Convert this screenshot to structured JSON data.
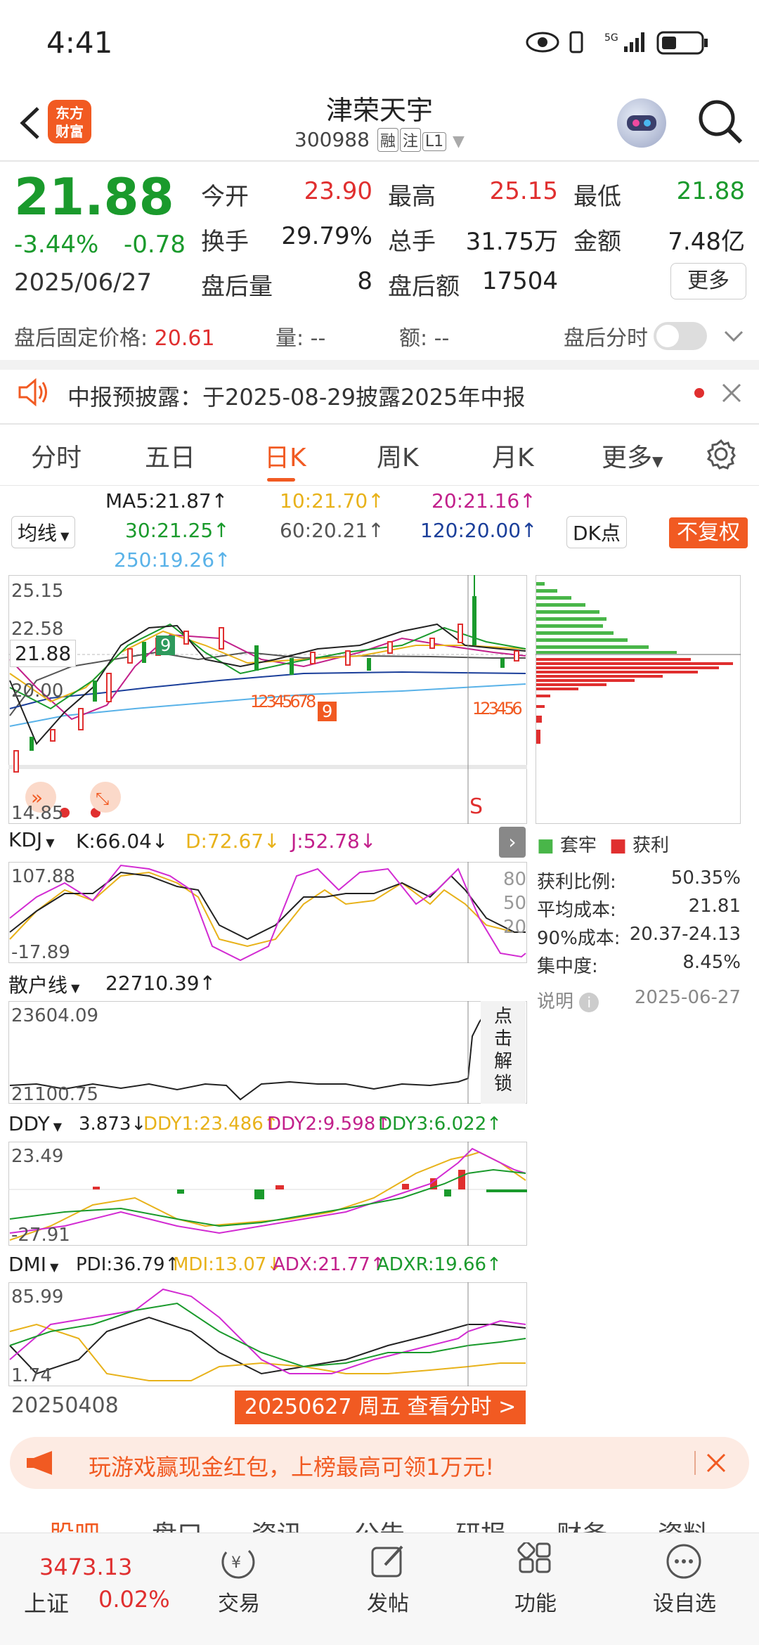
{
  "status": {
    "time": "4:41"
  },
  "header": {
    "name": "津荣天宇",
    "code": "300988",
    "tags": [
      "融",
      "注",
      "L1"
    ],
    "logo_lines": [
      "东方",
      "财富"
    ]
  },
  "quote": {
    "price": "21.88",
    "pct": "-3.44%",
    "change": "-0.78",
    "date": "2025/06/27",
    "fields": [
      {
        "label": "今开",
        "value": "23.90",
        "color": "red"
      },
      {
        "label": "最高",
        "value": "25.15",
        "color": "red"
      },
      {
        "label": "最低",
        "value": "21.88",
        "color": "green"
      },
      {
        "label": "换手",
        "value": "29.79%",
        "color": "plain"
      },
      {
        "label": "总手",
        "value": "31.75万",
        "color": "plain"
      },
      {
        "label": "金额",
        "value": "7.48亿",
        "color": "plain"
      },
      {
        "label": "盘后量",
        "value": "8",
        "color": "plain"
      },
      {
        "label": "盘后额",
        "value": "17504",
        "color": "plain"
      }
    ],
    "more": "更多"
  },
  "after_hours": {
    "fixed_label": "盘后固定价格:",
    "fixed_value": "20.61",
    "vol": "量: --",
    "amt": "额: --",
    "timeshare": "盘后分时"
  },
  "notice": {
    "text": "中报预披露：于2025-08-29披露2025年中报"
  },
  "tabs": [
    "分时",
    "五日",
    "日K",
    "周K",
    "月K",
    "更多"
  ],
  "ma": {
    "selector": "均线",
    "ma5": "MA5:21.87↑",
    "ma10": "10:21.70↑",
    "ma20": "20:21.16↑",
    "ma30": "30:21.25↑",
    "ma60": "60:20.21↑",
    "ma120": "120:20.00↑",
    "ma250": "250:19.26↑",
    "dk": "DK点",
    "fq": "不复权"
  },
  "kline": {
    "y_labels": [
      "25.15",
      "22.58",
      "20.00",
      "14.85"
    ],
    "current": "21.88",
    "signal": "S",
    "seq_upper": [
      "9"
    ],
    "seq_lower_a": [
      "1",
      "2",
      "3",
      "4",
      "5",
      "6",
      "7",
      "8",
      "9"
    ],
    "seq_lower_b": [
      "1",
      "2",
      "3",
      "4",
      "5",
      "6"
    ]
  },
  "chip": {
    "legend_a": "套牢",
    "legend_b": "获利",
    "rows": [
      {
        "label": "获利比例:",
        "value": "50.35%"
      },
      {
        "label": "平均成本:",
        "value": "21.81"
      },
      {
        "label": "90%成本:",
        "value": "20.37-24.13"
      },
      {
        "label": "集中度:",
        "value": "8.45%"
      }
    ],
    "note": "说明",
    "note_date": "2025-06-27"
  },
  "kdj": {
    "selector": "KDJ",
    "k": "K:66.04↓",
    "d": "D:72.67↓",
    "j": "J:52.78↓",
    "max": "107.88",
    "min": "-17.89",
    "ticks": [
      "80",
      "50",
      "20"
    ]
  },
  "sanhu": {
    "selector": "散户线",
    "value": "22710.39↑",
    "max": "23604.09",
    "min": "21100.75",
    "unlock": [
      "点",
      "击",
      "解",
      "锁"
    ]
  },
  "ddy": {
    "selector": "DDY",
    "v": "3.873↓",
    "ddy1": "DDY1:23.486↑",
    "ddy2": "DDY2:9.598↑",
    "ddy3": "DDY3:6.022↑",
    "max": "23.49",
    "min": "-27.91"
  },
  "dmi": {
    "selector": "DMI",
    "pdi": "PDI:36.79↑",
    "mdi": "MDI:13.07↓",
    "adx": "ADX:21.77↑",
    "adxr": "ADXR:19.66↑",
    "max": "85.99",
    "min": "1.74"
  },
  "footer": {
    "start_date": "20250408",
    "cta": "20250627 周五 查看分时 >"
  },
  "ad": {
    "text": "玩游戏赢现金红包，上榜最高可领1万元!"
  },
  "subtabs": [
    "股吧",
    "盘口",
    "资讯",
    "公告",
    "研报",
    "财务",
    "资料"
  ],
  "bottom": {
    "index_value": "3473.13",
    "index_name": "上证",
    "index_pct": "0.02%",
    "items": [
      "交易",
      "发帖",
      "功能",
      "设自选"
    ]
  },
  "colors": {
    "accent": "#f15a22",
    "up": "#e02f2f",
    "down": "#1a9a2c"
  }
}
